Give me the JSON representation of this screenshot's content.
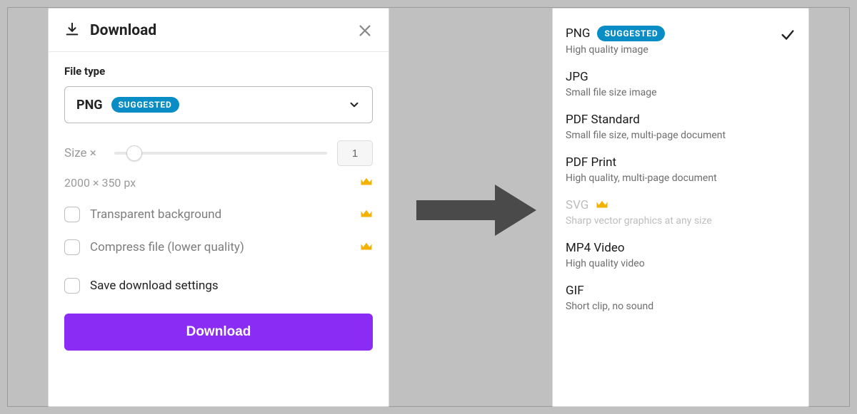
{
  "download_panel": {
    "title": "Download",
    "filetype_label": "File type",
    "selected_type": "PNG",
    "suggested_badge": "SUGGESTED",
    "size_label": "Size ×",
    "size_value": "1",
    "dimensions": "2000 × 350 px",
    "opt_transparent": "Transparent background",
    "opt_compress": "Compress file (lower quality)",
    "opt_save_settings": "Save download settings",
    "button": "Download"
  },
  "filetype_list": [
    {
      "name": "PNG",
      "sub": "High quality image",
      "suggested": true,
      "selected": true,
      "premium": false,
      "disabled": false
    },
    {
      "name": "JPG",
      "sub": "Small file size image",
      "suggested": false,
      "selected": false,
      "premium": false,
      "disabled": false
    },
    {
      "name": "PDF Standard",
      "sub": "Small file size, multi-page document",
      "suggested": false,
      "selected": false,
      "premium": false,
      "disabled": false
    },
    {
      "name": "PDF Print",
      "sub": "High quality, multi-page document",
      "suggested": false,
      "selected": false,
      "premium": false,
      "disabled": false
    },
    {
      "name": "SVG",
      "sub": "Sharp vector graphics at any size",
      "suggested": false,
      "selected": false,
      "premium": true,
      "disabled": true
    },
    {
      "name": "MP4 Video",
      "sub": "High quality video",
      "suggested": false,
      "selected": false,
      "premium": false,
      "disabled": false
    },
    {
      "name": "GIF",
      "sub": "Short clip, no sound",
      "suggested": false,
      "selected": false,
      "premium": false,
      "disabled": false
    }
  ],
  "colors": {
    "accent": "#8b2cf5",
    "badge": "#0a8dc4",
    "crown": "#f3b100"
  }
}
